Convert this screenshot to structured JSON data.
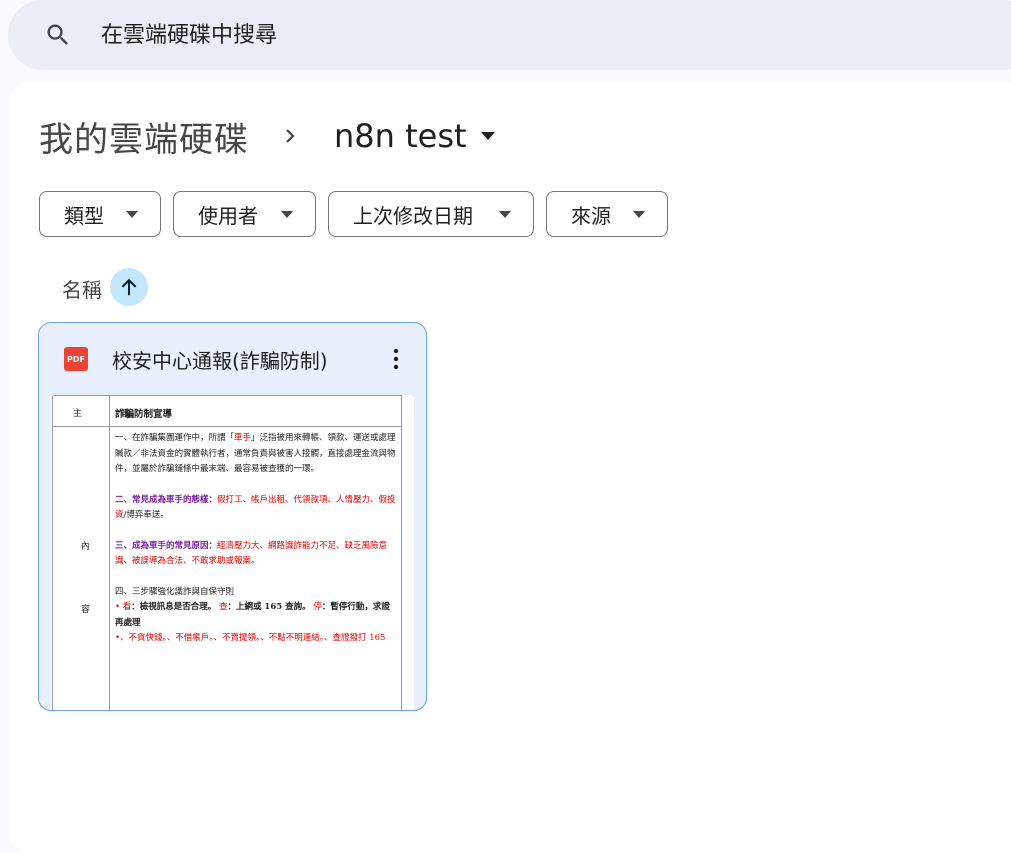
{
  "search": {
    "placeholder": "在雲端硬碟中搜尋",
    "icon": "search-icon"
  },
  "breadcrumb": {
    "root": "我的雲端硬碟",
    "current": "n8n test"
  },
  "filters": [
    {
      "label": "類型"
    },
    {
      "label": "使用者"
    },
    {
      "label": "上次修改日期"
    },
    {
      "label": "來源"
    }
  ],
  "sort": {
    "label": "名稱",
    "direction": "ascending"
  },
  "files": [
    {
      "name": "校安中心通報(詐騙防制)",
      "type_icon": "PDF",
      "preview": {
        "subject_label": "主 旨",
        "subject": "詐騙防制宣導",
        "side_labels": [
          "內",
          "容"
        ],
        "para1": {
          "a": "一、在詐騙集團運作中，所謂「",
          "b": "車手",
          "c": "」泛指被用來轉帳、領款、運送或處理贓款／非法資金的實體執行者，通常負責與被害人接觸，直接處理金流與物件，並屬於詐騙鏈條中最末端、最容易被查獲的一環。"
        },
        "para2": {
          "a": "二、常見成為車手的態樣：",
          "b": "假打工、帳戶出租、代領款項、人情壓力、假投資",
          "c": "/博弈奉送。"
        },
        "para3": {
          "a": "三、成為車手的常見原因：",
          "b": "經濟壓力大、網路識詐能力不足、缺乏風險意識、被誤導為合法、不敢求助或報案。"
        },
        "para4": {
          "title": "四、三步驟強化識詐與自保守則",
          "bullet1_a": "•  看",
          "bullet1_b": "：檢視訊息是否合理。",
          "bullet1_c": "查",
          "bullet1_d": "：上網或 165 查詢。",
          "bullet1_e": "停",
          "bullet1_f": "：暫停行動，求證再處理",
          "bullet2": "•、不貪快錢。、不借帳戶。、不賣提領。、不點不明連結。、查證撥打 165"
        }
      }
    }
  ],
  "colors": {
    "page_bg": "#f8fafd",
    "search_bg": "#e9eef6",
    "card_selected_bg": "#e8f0fe",
    "card_border": "#6d9eeb",
    "sort_btn_bg": "#c2e7ff",
    "pdf_red": "#ea4335"
  }
}
